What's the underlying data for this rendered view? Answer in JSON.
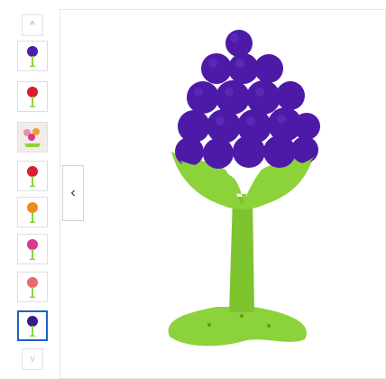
{
  "gallery": {
    "scroll_up_icon": "chevron-up-icon",
    "scroll_down_icon": "chevron-down-icon",
    "prev_icon": "chevron-left-icon",
    "thumbnails": [
      {
        "color": "#4b1fa8",
        "variant": "grape"
      },
      {
        "color": "#d81e2e",
        "variant": "strawberry"
      },
      {
        "color": "#e8a0b8",
        "variant": "multi"
      },
      {
        "color": "#d81e2e",
        "variant": "strawberry"
      },
      {
        "color": "#f08a1c",
        "variant": "orange"
      },
      {
        "color": "#d63a8a",
        "variant": "berry"
      },
      {
        "color": "#e86a6a",
        "variant": "peach"
      },
      {
        "color": "#3a1a8a",
        "variant": "grape"
      }
    ],
    "selected_index": 7,
    "main_image": {
      "subject": "grape-teether",
      "fruit_color": "#4d1aa8",
      "stem_color": "#8cd23a"
    }
  },
  "glyphs": {
    "up": "^",
    "down": "v",
    "left": "‹"
  }
}
